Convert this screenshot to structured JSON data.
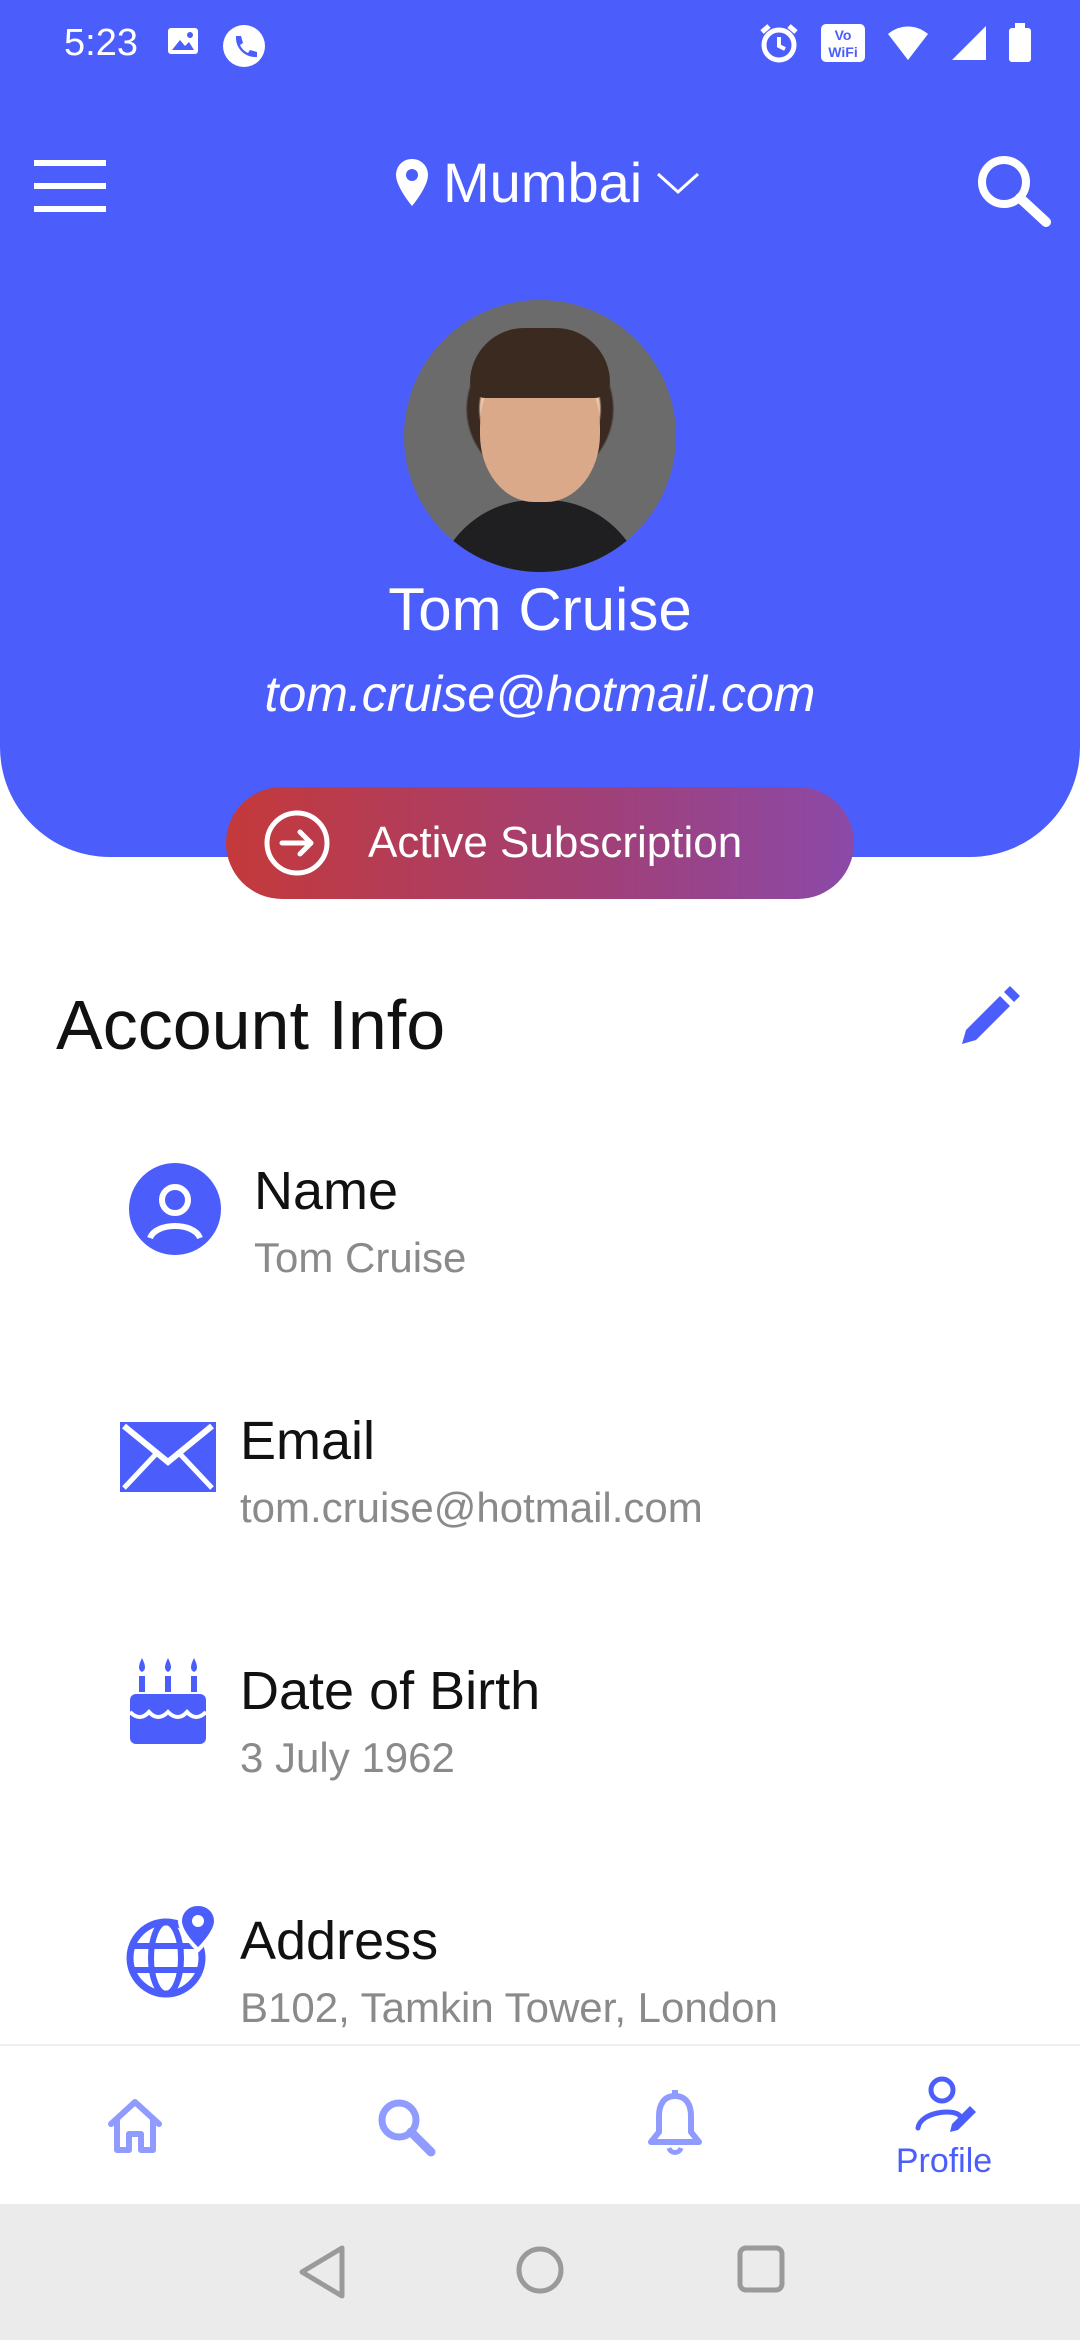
{
  "status_bar": {
    "time": "5:23",
    "icons": [
      "image-icon",
      "phone-call-icon",
      "alarm-icon",
      "vowifi-icon",
      "wifi-icon",
      "signal-icon",
      "battery-icon"
    ],
    "vowifi_text": "Vo WiFi"
  },
  "app_bar": {
    "location": "Mumbai",
    "icons": [
      "menu-icon",
      "location-pin-icon",
      "chevron-down-icon",
      "search-icon"
    ]
  },
  "profile": {
    "name": "Tom Cruise",
    "email": "tom.cruise@hotmail.com",
    "subscription_label": "Active Subscription"
  },
  "account_info": {
    "title": "Account Info",
    "fields": [
      {
        "icon": "user-circle-icon",
        "label": "Name",
        "value": "Tom Cruise"
      },
      {
        "icon": "envelope-icon",
        "label": "Email",
        "value": "tom.cruise@hotmail.com"
      },
      {
        "icon": "birthday-cake-icon",
        "label": "Date of Birth",
        "value": "3 July 1962"
      },
      {
        "icon": "globe-pin-icon",
        "label": "Address",
        "value": "B102, Tamkin Tower, London"
      }
    ]
  },
  "bottom_nav": {
    "items": [
      {
        "icon": "home-icon",
        "label": ""
      },
      {
        "icon": "search-icon",
        "label": ""
      },
      {
        "icon": "bell-icon",
        "label": ""
      },
      {
        "icon": "profile-edit-icon",
        "label": "Profile"
      }
    ],
    "active_index": 3
  },
  "colors": {
    "primary": "#4b5efc",
    "pill_start": "#c4393a",
    "pill_end": "#8b49a8",
    "text_dark": "#111111",
    "text_muted": "#8a8a8a"
  }
}
